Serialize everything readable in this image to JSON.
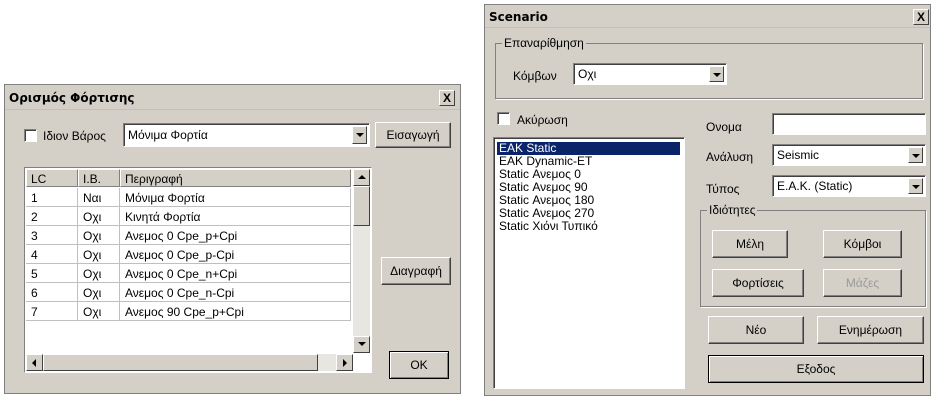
{
  "load_dialog": {
    "title": "Ορισμός Φόρτισης",
    "close": "X",
    "self_weight_label": "Ιδιον Βάρος",
    "load_type_value": "Μόνιμα Φορτία",
    "insert_button": "Εισαγωγή",
    "delete_button": "Διαγραφή",
    "ok_button": "OK",
    "columns": [
      "LC",
      "I.B.",
      "Περιγραφή"
    ],
    "rows": [
      {
        "lc": "1",
        "ib": "Ναι",
        "desc": "Μόνιμα Φορτία"
      },
      {
        "lc": "2",
        "ib": "Οχι",
        "desc": "Κινητά Φορτία"
      },
      {
        "lc": "3",
        "ib": "Οχι",
        "desc": "Ανεμος 0 Cpe_p+Cpi"
      },
      {
        "lc": "4",
        "ib": "Οχι",
        "desc": "Ανεμος 0 Cpe_p-Cpi"
      },
      {
        "lc": "5",
        "ib": "Οχι",
        "desc": "Ανεμος 0 Cpe_n+Cpi"
      },
      {
        "lc": "6",
        "ib": "Οχι",
        "desc": "Ανεμος 0 Cpe_n-Cpi"
      },
      {
        "lc": "7",
        "ib": "Οχι",
        "desc": "Ανεμος 90 Cpe_p+Cpi"
      }
    ]
  },
  "scenario_dialog": {
    "title": "Scenario",
    "close": "X",
    "numbering_group": "Επαναρίθμηση",
    "nodes_label": "Κόμβων",
    "nodes_value": "Οχι",
    "cancel_label": "Ακύρωση",
    "scenarios": [
      "EAK Static",
      "EAK Dynamic-ET",
      "Static Ανεμος 0",
      "Static Ανεμος 90",
      "Static Ανεμος 180",
      "Static Ανεμος 270",
      "Static Χιόνι Τυπικό"
    ],
    "selected_index": 0,
    "name_label": "Ονομα",
    "name_value": "",
    "analysis_label": "Ανάλυση",
    "analysis_value": "Seismic",
    "type_label": "Τύπος",
    "type_value": "E.A.K. (Static)",
    "properties_group": "Ιδιότητες",
    "members_button": "Μέλη",
    "nodes_button": "Κόμβοι",
    "loads_button": "Φορτίσεις",
    "masses_button": "Μάζες",
    "new_button": "Νέο",
    "update_button": "Ενημέρωση",
    "exit_button": "Εξοδος"
  }
}
